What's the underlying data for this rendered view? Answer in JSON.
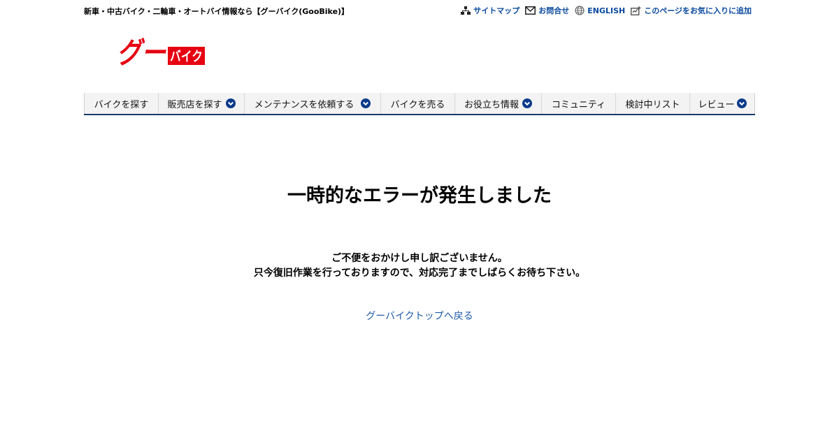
{
  "header": {
    "tagline": "新車・中古バイク・二輪車・オートバイ情報なら【グーバイク(GooBike)】",
    "links": [
      {
        "label": "サイトマップ",
        "icon": "sitemap-icon"
      },
      {
        "label": "お問合せ",
        "icon": "mail-icon"
      },
      {
        "label": "ENGLISH",
        "icon": "globe-icon"
      },
      {
        "label": "このページをお気に入りに追加",
        "icon": "bookmark-add-icon"
      }
    ],
    "logo": {
      "text_main": "グー",
      "text_sub": "バイク",
      "brand_red": "#e60012"
    }
  },
  "nav": {
    "items": [
      {
        "label": "バイクを探す",
        "dropdown": false
      },
      {
        "label": "販売店を探す",
        "dropdown": true
      },
      {
        "label": "メンテナンスを依頼する",
        "dropdown": true
      },
      {
        "label": "バイクを売る",
        "dropdown": false
      },
      {
        "label": "お役立ち情報",
        "dropdown": true
      },
      {
        "label": "コミュニティ",
        "dropdown": false
      },
      {
        "label": "検討中リスト",
        "dropdown": false
      },
      {
        "label": "レビュー",
        "dropdown": true
      }
    ],
    "accent": "#0a3a8a"
  },
  "main": {
    "title": "一時的なエラーが発生しました",
    "message_line1": "ご不便をおかけし申し訳ございません。",
    "message_line2": "只今復旧作業を行っておりますので、対応完了までしばらくお待ち下さい。",
    "back_link": "グーバイクトップへ戻る"
  }
}
